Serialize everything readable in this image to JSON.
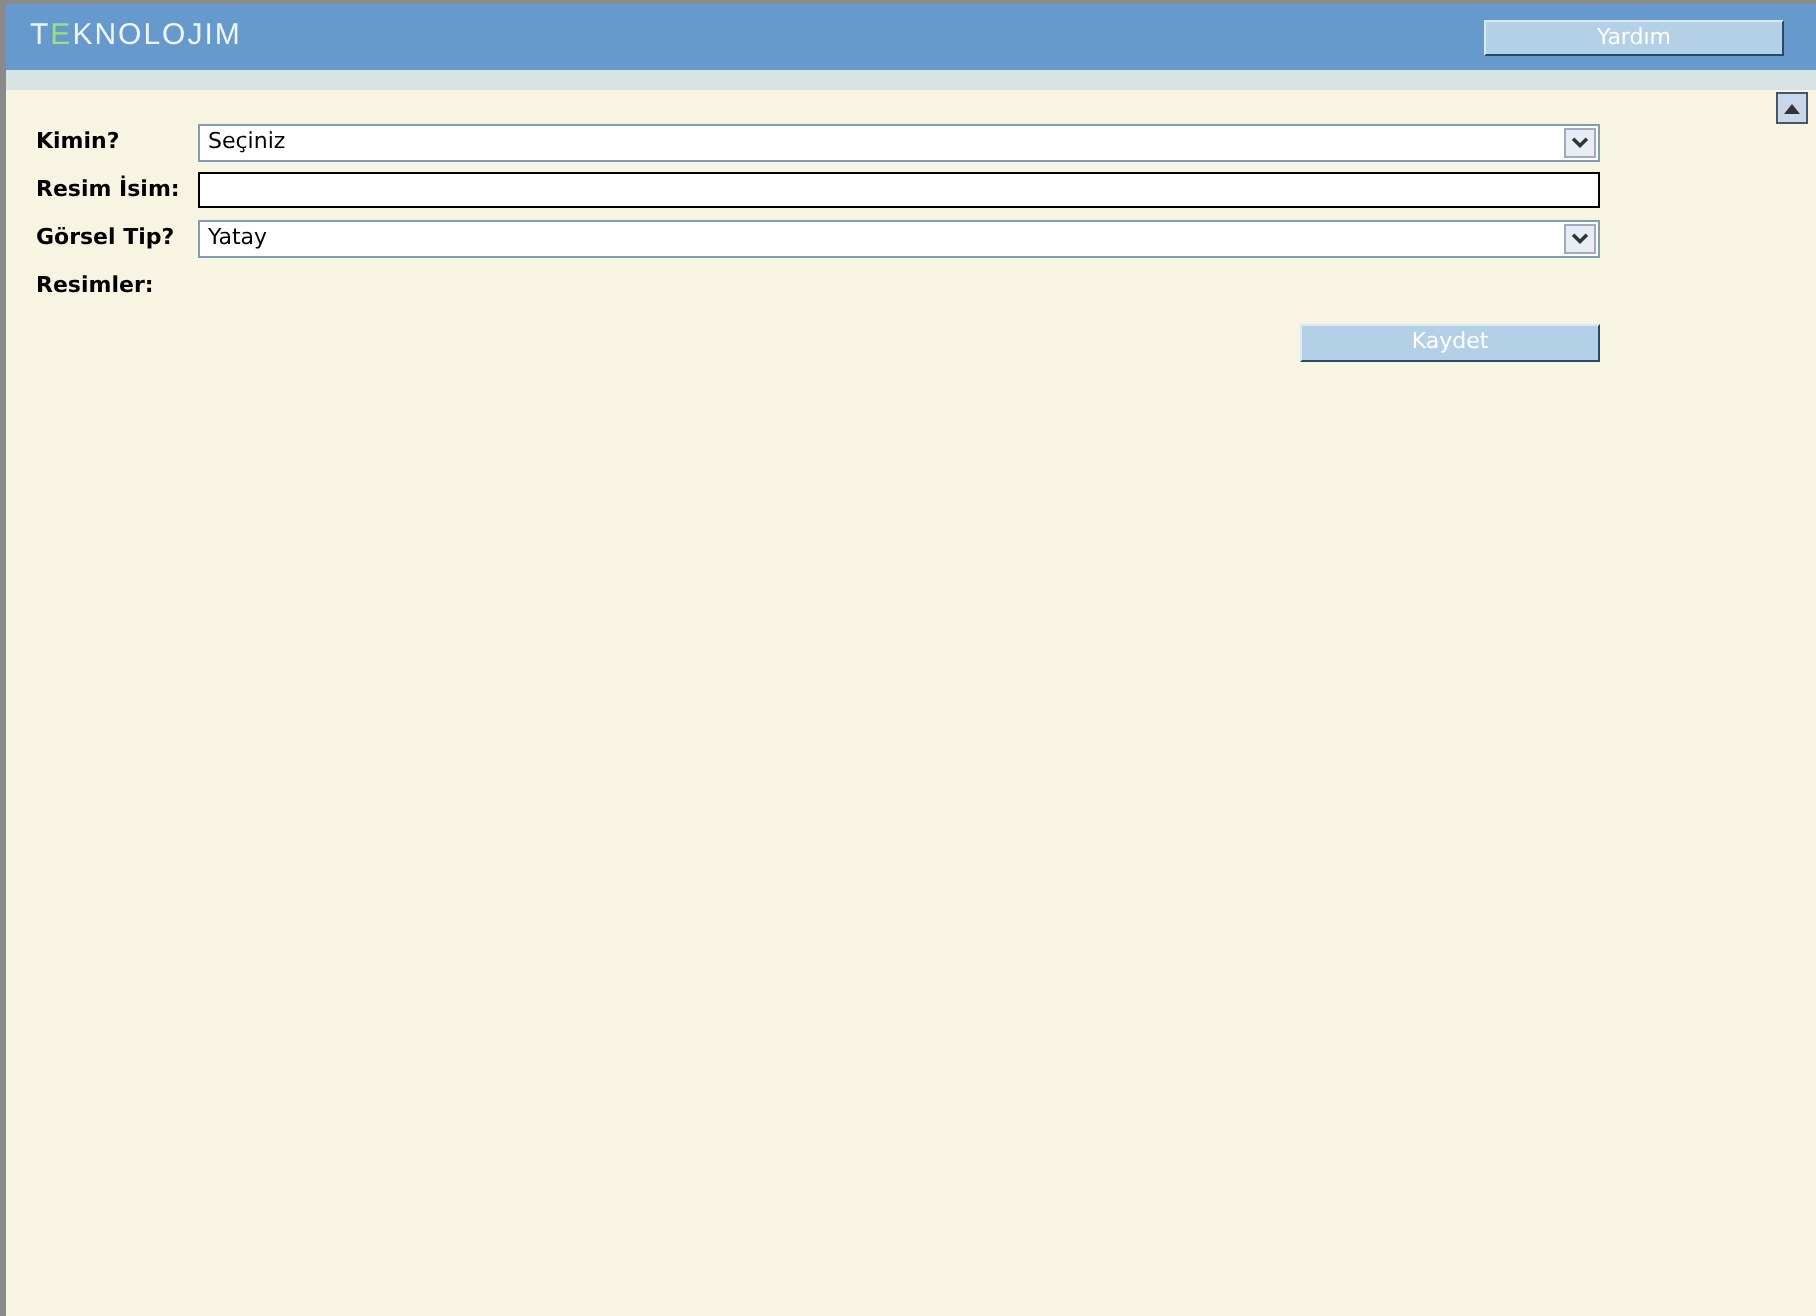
{
  "header": {
    "logo": {
      "parts": [
        {
          "text": "T",
          "color": "#eef4fa"
        },
        {
          "text": "E",
          "color": "#9be07a"
        },
        {
          "text": "KNOLOJIM",
          "color": "#eef4fa"
        }
      ]
    },
    "help_button": "Yardım"
  },
  "form": {
    "fields": [
      {
        "label": "Kimin?",
        "kind": "select",
        "value": "Seçiniz"
      },
      {
        "label": "Resim İsim:",
        "kind": "text"
      },
      {
        "label": "Görsel Tip?",
        "kind": "select",
        "value": "Yatay"
      },
      {
        "label": "Resimler:",
        "kind": "none"
      }
    ],
    "save_button": "Kaydet"
  }
}
